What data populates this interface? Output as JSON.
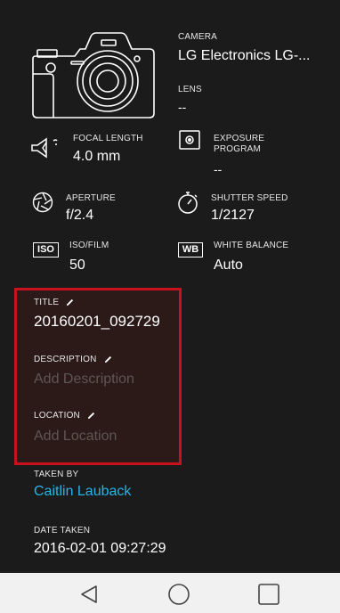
{
  "camera": {
    "label": "CAMERA",
    "value": "LG Electronics LG-..."
  },
  "lens": {
    "label": "LENS",
    "value": "--"
  },
  "focal_length": {
    "label": "FOCAL LENGTH",
    "value": "4.0 mm"
  },
  "exposure_program": {
    "label_line1": "EXPOSURE",
    "label_line2": "PROGRAM",
    "value": "--"
  },
  "aperture": {
    "label": "APERTURE",
    "value": "f/2.4"
  },
  "shutter_speed": {
    "label": "SHUTTER SPEED",
    "value": "1/2127"
  },
  "iso": {
    "badge": "ISO",
    "label": "ISO/FILM",
    "value": "50"
  },
  "white_balance": {
    "badge": "WB",
    "label": "WHITE BALANCE",
    "value": "Auto"
  },
  "editable": {
    "title": {
      "label": "TITLE",
      "value": "20160201_092729"
    },
    "description": {
      "label": "DESCRIPTION",
      "placeholder": "Add Description"
    },
    "location": {
      "label": "LOCATION",
      "placeholder": "Add Location"
    }
  },
  "taken_by": {
    "label": "TAKEN BY",
    "value": "Caitlin Lauback"
  },
  "date_taken": {
    "label": "DATE TAKEN",
    "value": "2016-02-01 09:27:29"
  },
  "colors": {
    "background": "#1b1b1b",
    "highlight_border": "#c8121d",
    "link": "#27b4e6",
    "navbar": "#f1f1f1"
  },
  "navbar": {
    "icons": [
      "back-icon",
      "home-icon",
      "recents-icon"
    ]
  }
}
